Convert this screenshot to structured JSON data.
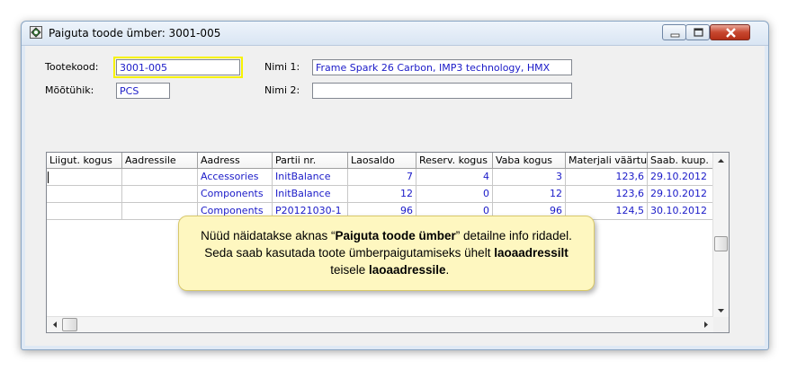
{
  "window": {
    "title": "Paiguta toode ümber: 3001-005"
  },
  "form": {
    "tootekood_label": "Tootekood:",
    "tootekood_value": "3001-005",
    "mootuhik_label": "Mõõtühik:",
    "mootuhik_value": "PCS",
    "nimi1_label": "Nimi 1:",
    "nimi1_value": "Frame Spark 26 Carbon, IMP3 technology, HMX",
    "nimi2_label": "Nimi 2:",
    "nimi2_value": ""
  },
  "grid": {
    "columns": [
      "Liigut. kogus",
      "Aadressile",
      "Aadress",
      "Partii nr.",
      "Laosaldo",
      "Reserv. kogus",
      "Vaba kogus",
      "Materjali väärtus",
      "Saab. kuup."
    ],
    "rows": [
      [
        "",
        "",
        "Accessories",
        "InitBalance",
        "7",
        "4",
        "3",
        "123,6",
        "29.10.2012"
      ],
      [
        "",
        "",
        "Components",
        "InitBalance",
        "12",
        "0",
        "12",
        "123,6",
        "29.10.2012"
      ],
      [
        "",
        "",
        "Components",
        "P20121030-1",
        "96",
        "0",
        "96",
        "124,5",
        "30.10.2012"
      ]
    ]
  },
  "callout": {
    "t1": "Nüüd näidatakse aknas “",
    "b1": "Paiguta toode ümber",
    "t2": "” detailne info ridadel. Seda saab kasutada toote ümberpaigutamiseks ühelt ",
    "b2": "laoaadressilt",
    "t3": "  teisele ",
    "b3": "laoaadressile",
    "t4": "."
  },
  "colors": {
    "value_text": "#1a1ac8",
    "highlight": "#f7f300",
    "callout_bg": "#fef7c0"
  }
}
